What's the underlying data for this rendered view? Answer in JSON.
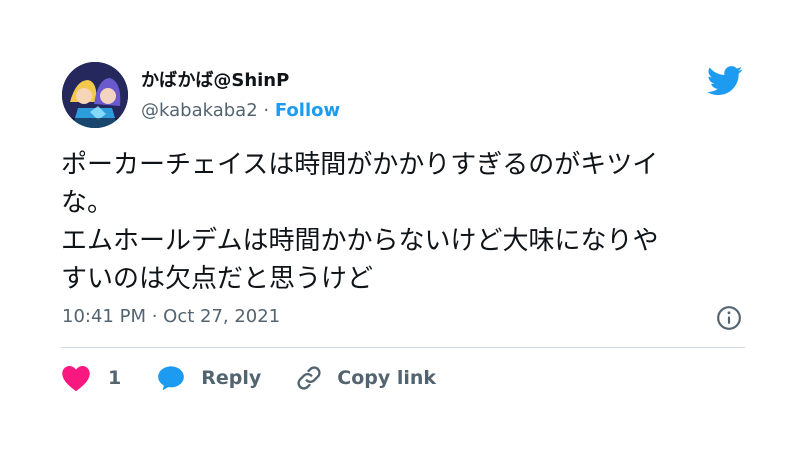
{
  "author": {
    "display_name": "かばかば@ShinP",
    "handle": "@kabakaba2",
    "separator": "·",
    "follow_label": "Follow"
  },
  "tweet": {
    "lines": [
      "ポーカーチェイスは時間がかかりすぎるのがキツイ",
      "な。",
      "エムホールデムは時間かからないけど大味になりや",
      "すいのは欠点だと思うけど"
    ]
  },
  "meta": {
    "timestamp": "10:41 PM · Oct 27, 2021"
  },
  "actions": {
    "like_count": "1",
    "reply_label": "Reply",
    "copy_link_label": "Copy link"
  },
  "colors": {
    "accent": "#1d9bf0",
    "like": "#f91880",
    "muted_text": "#536471",
    "divider": "#cfd9de"
  },
  "icons": [
    "twitter-bird-icon",
    "info-icon",
    "heart-icon",
    "reply-bubble-icon",
    "link-icon"
  ]
}
